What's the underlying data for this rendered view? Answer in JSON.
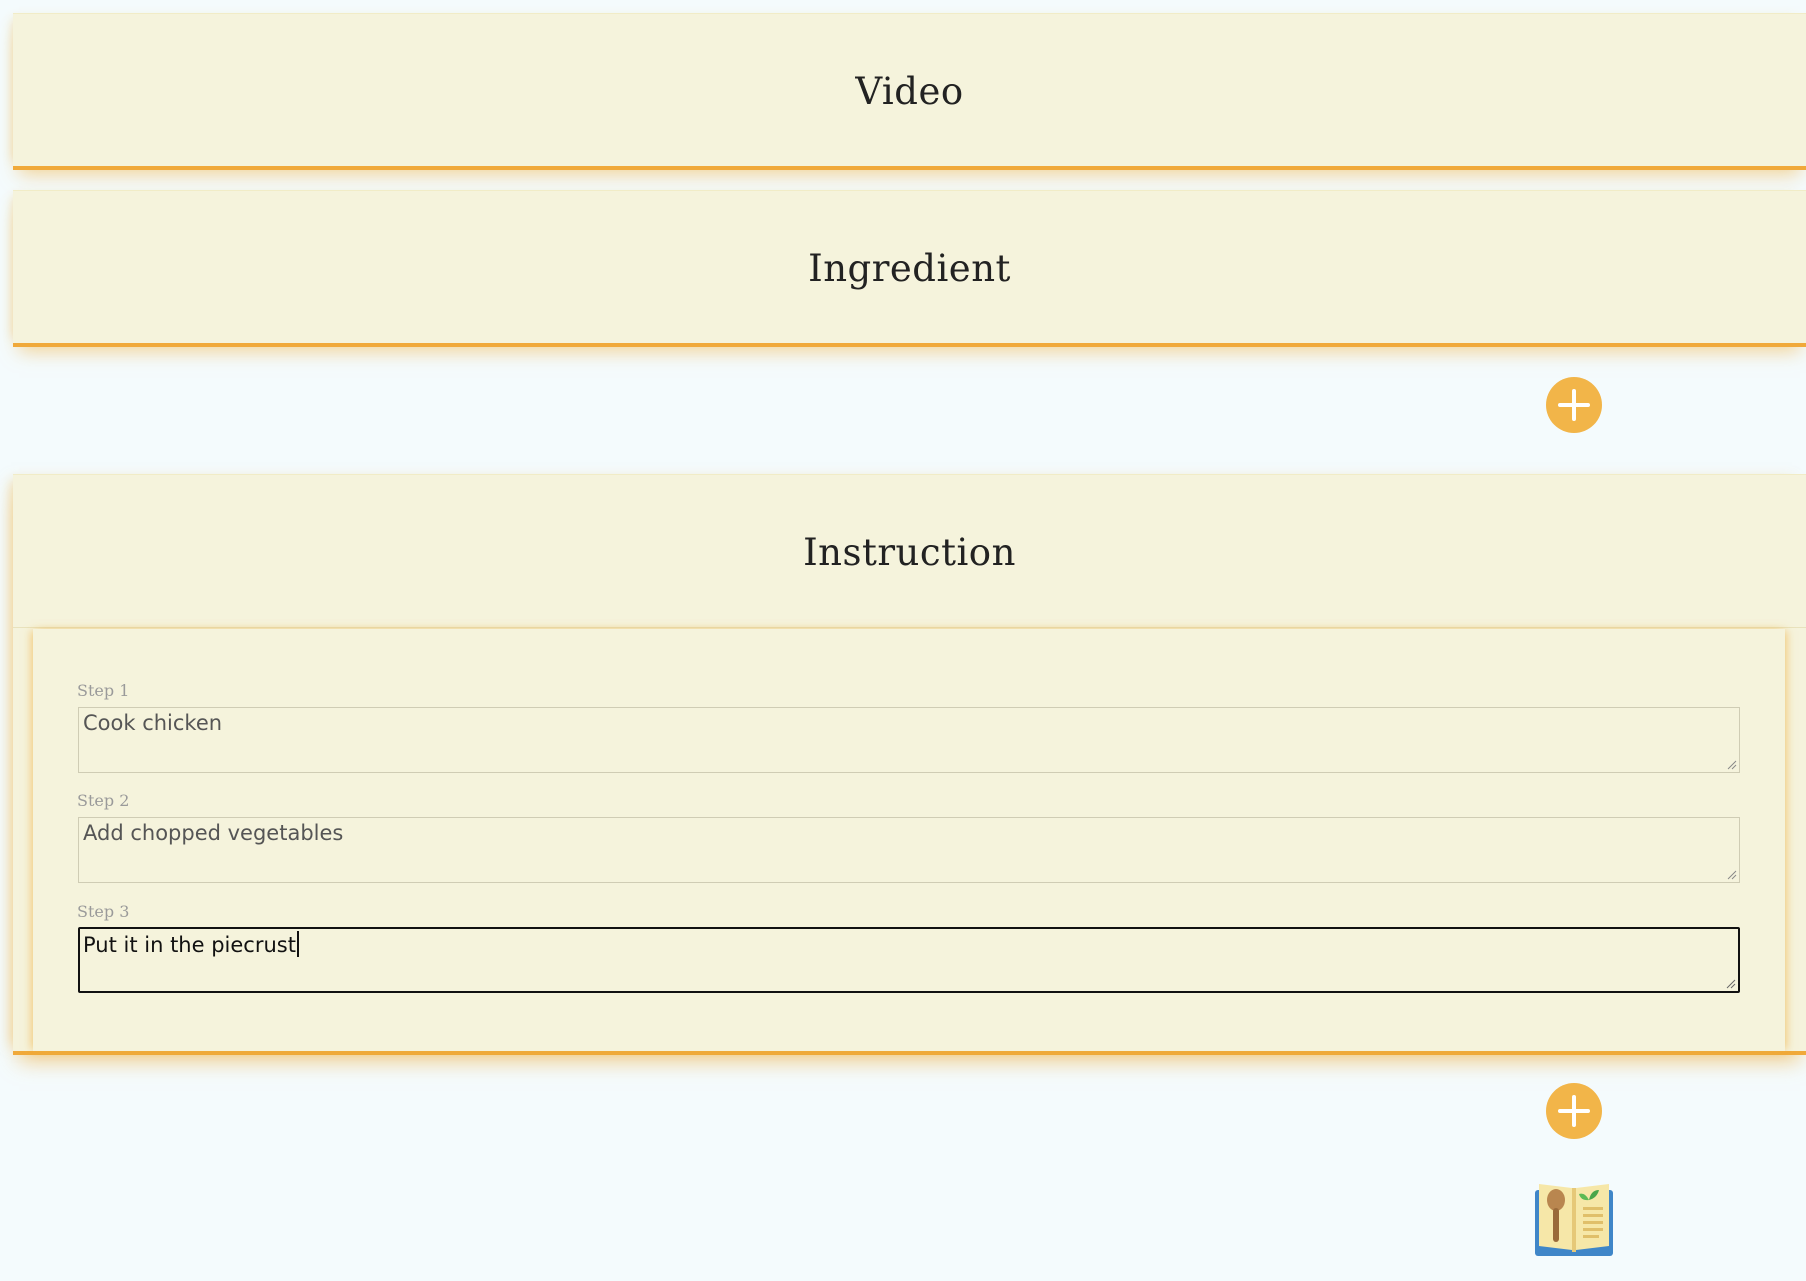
{
  "sections": {
    "video_title": "Video",
    "ingredient_title": "Ingredient",
    "instruction_title": "Instruction"
  },
  "steps": [
    {
      "label": "Step 1",
      "value": "Cook chicken"
    },
    {
      "label": "Step 2",
      "value": "Add chopped vegetables"
    },
    {
      "label": "Step 3",
      "value": "Put it in the piecrust"
    }
  ],
  "icons": {
    "add_ingredient": "plus-icon",
    "add_step": "plus-icon",
    "logo": "cookbook-icon"
  },
  "colors": {
    "accent": "#f2b549",
    "panel_background": "#f5f3dc",
    "page_background": "#f4fbfd",
    "shadow": "#f0a93a"
  }
}
